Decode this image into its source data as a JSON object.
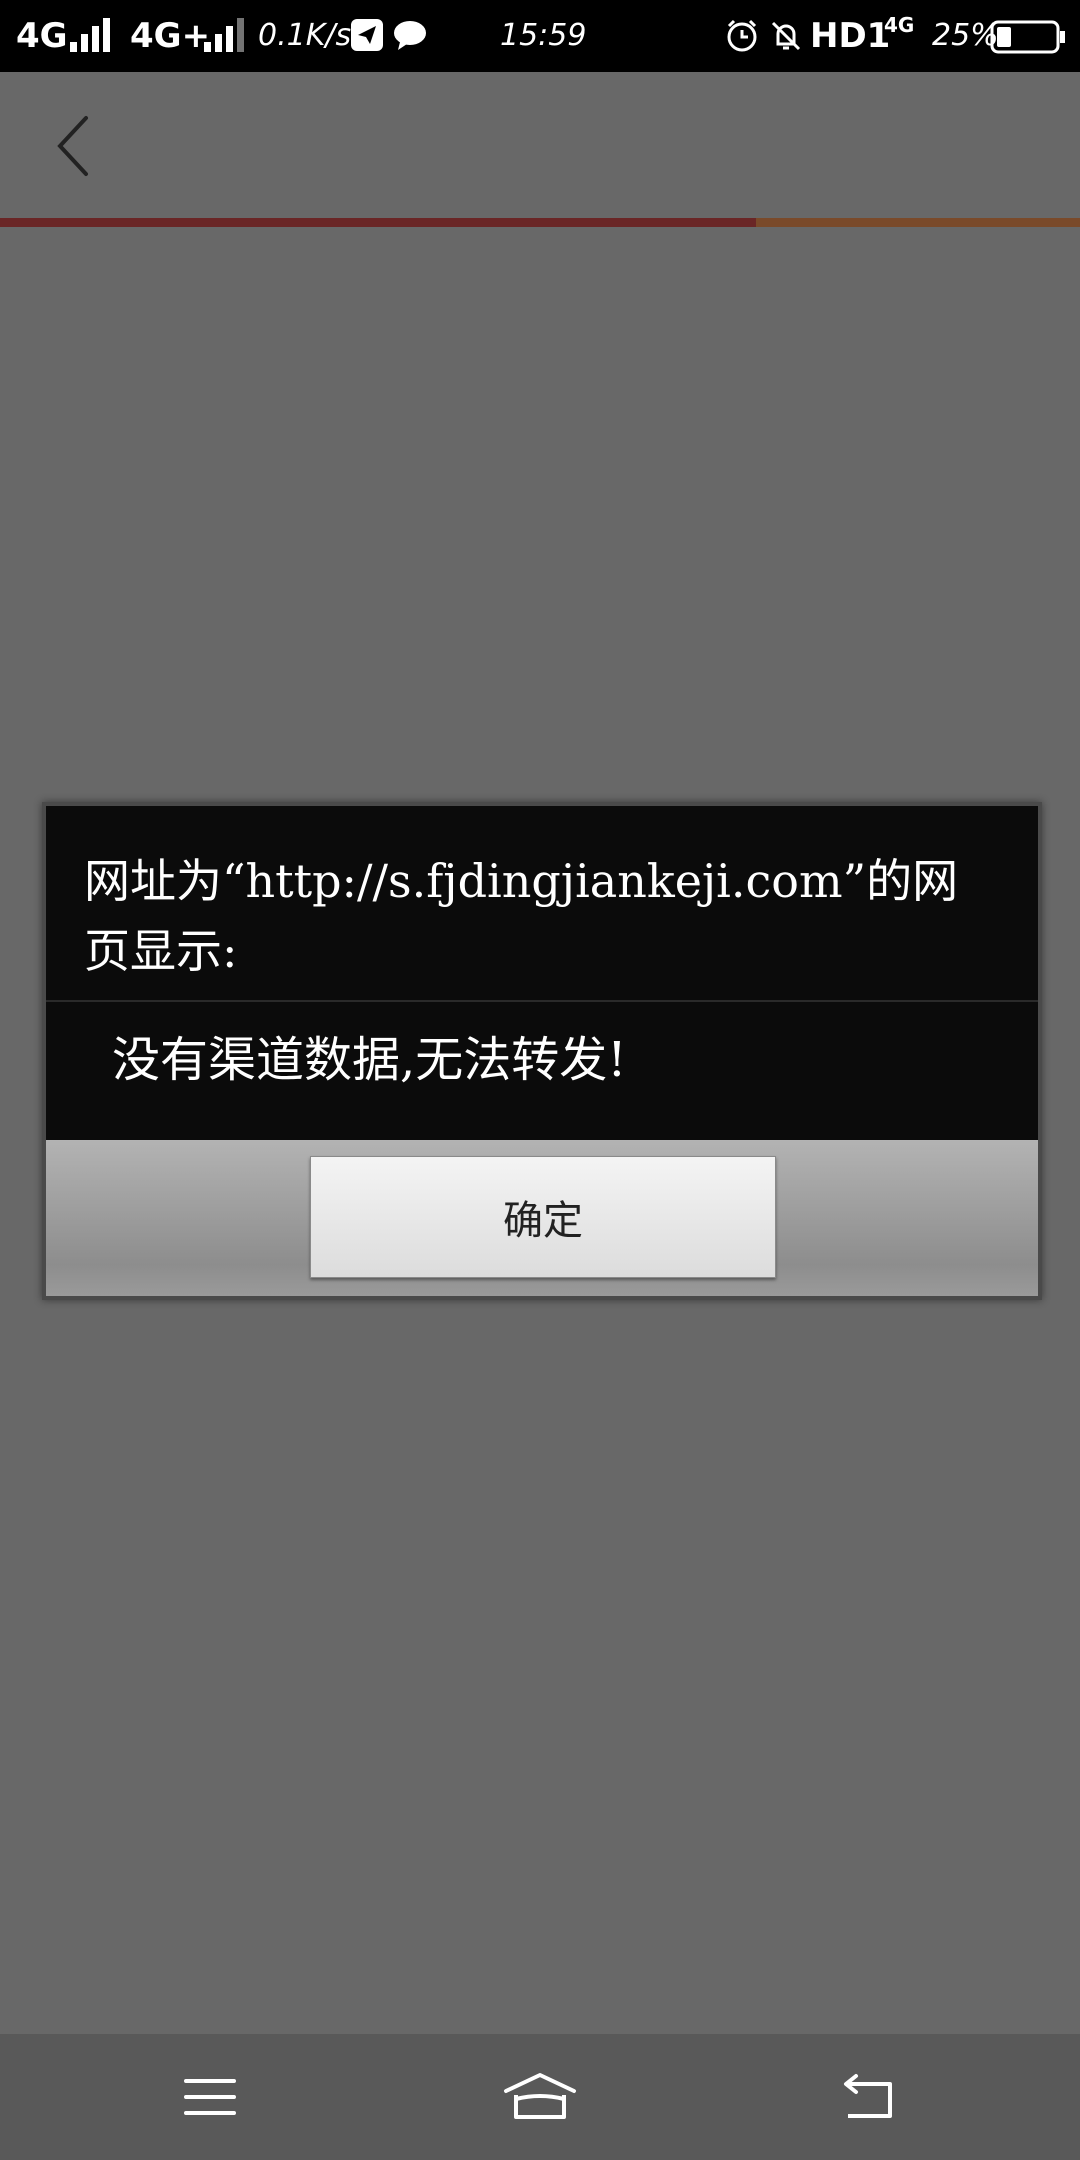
{
  "status_bar": {
    "network1": "4G",
    "network2": "4G+",
    "speed": "0.1K/s",
    "time": "15:59",
    "hd": "HD1",
    "network3": "4G",
    "battery": "25%"
  },
  "page": {
    "load_progress": 0.7
  },
  "dialog": {
    "title": "网址为“http://s.fjdingjiankeji.com”的网页显示:",
    "message": "没有渠道数据,无法转发!",
    "ok_label": "确定"
  },
  "nav_bar": {
    "icons": [
      "menu-icon",
      "home-icon",
      "back-icon"
    ]
  },
  "colors": {
    "status_bar": "#000000",
    "background": "#686868",
    "dialog_body": "#0b0b0b",
    "progress": "#6a2626"
  }
}
